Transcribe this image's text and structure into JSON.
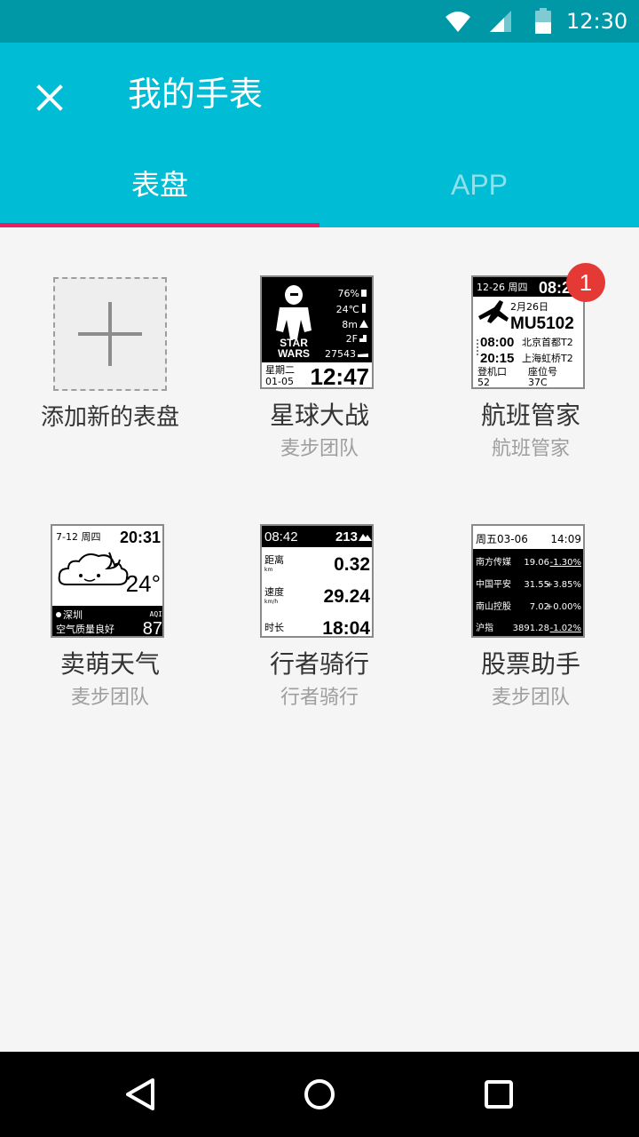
{
  "status_bar": {
    "time": "12:30",
    "icons": [
      "wifi-icon",
      "cell-signal-icon",
      "battery-icon"
    ]
  },
  "app_bar": {
    "title": "我的手表",
    "close_icon": "close-icon",
    "tabs": [
      {
        "label": "表盘",
        "selected": true
      },
      {
        "label": "APP",
        "selected": false
      }
    ],
    "colors": {
      "primary": "#00bcd4",
      "status": "#0097a7",
      "indicator": "#e91e63"
    }
  },
  "add_watchface": {
    "label": "添加新的表盘",
    "icon": "plus-icon"
  },
  "watchfaces": [
    {
      "title": "星球大战",
      "author": "麦步团队",
      "screen": {
        "stats": [
          "76%",
          "24℃",
          "8m",
          "2F",
          "27543"
        ],
        "logo_top": "STAR",
        "logo_bottom": "WARS",
        "weekday": "星期二",
        "date": "01-05",
        "time": "12:47"
      }
    },
    {
      "title": "航班管家",
      "author": "航班管家",
      "badge": "1",
      "screen": {
        "header_date": "12-26 周四",
        "header_time": "08:2",
        "flight_date": "2月26日",
        "flight_no": "MU5102",
        "dep_time": "08:00",
        "dep_airport": "北京首都T2",
        "arr_time": "20:15",
        "arr_airport": "上海虹桥T2",
        "gate_label": "登机口",
        "gate": "52",
        "seat_label": "座位号",
        "seat": "37C"
      }
    },
    {
      "title": "卖萌天气",
      "author": "麦步团队",
      "screen": {
        "date": "7-12 周四",
        "time": "20:31",
        "temp": "24°",
        "city": "深圳",
        "aqi_label": "AQI",
        "aqi_text": "空气质量良好",
        "aqi": "87"
      }
    },
    {
      "title": "行者骑行",
      "author": "行者骑行",
      "screen": {
        "time": "08:42",
        "altitude": "213",
        "dist_label": "距离",
        "dist_unit": "km",
        "dist": "0.32",
        "speed_label": "速度",
        "speed_unit": "km/h",
        "speed": "29.24",
        "dur_label": "时长",
        "dur": "18:04"
      }
    },
    {
      "title": "股票助手",
      "author": "麦步团队",
      "screen": {
        "header_date": "周五03-06",
        "header_time": "14:09",
        "stocks": [
          {
            "name": "南方传媒",
            "price": "19.06",
            "change": "-1.30%"
          },
          {
            "name": "中国平安",
            "price": "31.55",
            "change": "+3.85%"
          },
          {
            "name": "南山控股",
            "price": "7.02",
            "change": "+0.00%"
          },
          {
            "name": "沪指",
            "price": "3891.28",
            "change": "-1.02%"
          }
        ]
      }
    }
  ],
  "nav_bar": {
    "icons": [
      "back-icon",
      "home-icon",
      "recents-icon"
    ]
  }
}
